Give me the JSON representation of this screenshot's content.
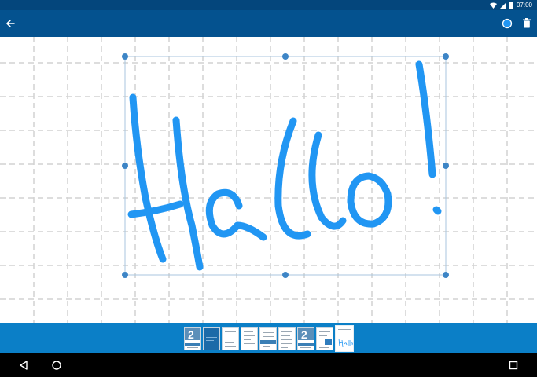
{
  "status_bar": {
    "time": "07:00",
    "icons": [
      "wifi-icon",
      "signal-icon",
      "battery-icon"
    ]
  },
  "app_bar": {
    "back_icon": "arrow-back-icon",
    "color_icon": "color-circle-icon",
    "delete_icon": "trash-icon",
    "pen_color": "#2196f3"
  },
  "drawing": {
    "content": "Hallo!",
    "stroke_color": "#2196f3",
    "grid_color": "#cfcfcf",
    "selection_color": "#3d85c6"
  },
  "thumbnail_strip": {
    "count": 9,
    "selected_index": 8,
    "background": "#0b7fc7"
  },
  "nav_bar": {
    "icons": [
      "back-triangle-icon",
      "home-circle-icon",
      "recents-square-icon"
    ]
  }
}
